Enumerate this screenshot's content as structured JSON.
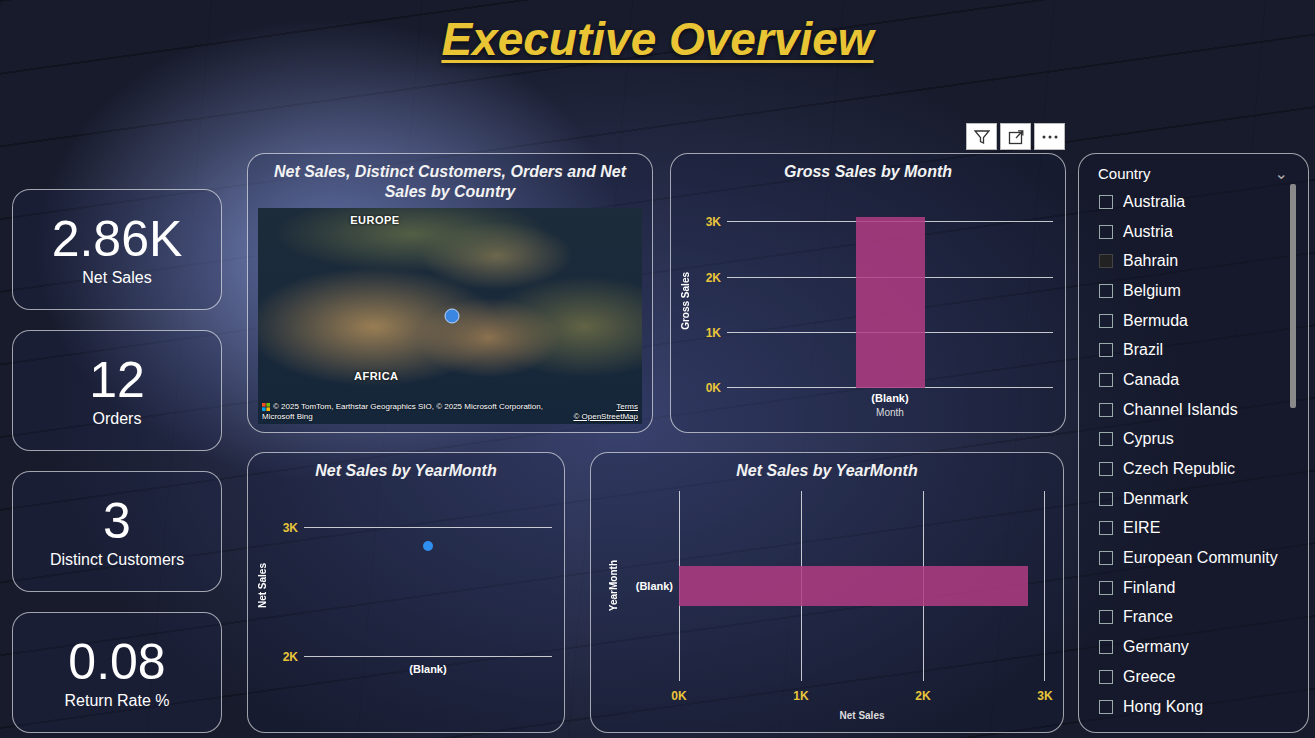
{
  "title": "Executive Overview",
  "kpis": [
    {
      "value": "2.86K",
      "label": "Net Sales"
    },
    {
      "value": "12",
      "label": "Orders"
    },
    {
      "value": "3",
      "label": "Distinct Customers"
    },
    {
      "value": "0.08",
      "label": "Return Rate %"
    }
  ],
  "map": {
    "title": "Net Sales, Distinct Customers, Orders and Net Sales by Country",
    "labels": [
      "EUROPE",
      "AFRICA"
    ],
    "attribution": "© 2025 TomTom, Earthstar Geographics SIO, © 2025 Microsoft Corporation,",
    "terms": "Terms",
    "brand": "Microsoft Bing",
    "osm": "© OpenStreetMap"
  },
  "gross_chart": {
    "title": "Gross Sales by Month",
    "y_axis_title": "Gross Sales",
    "x_axis_title": "Month",
    "ticks": [
      {
        "label": "3K",
        "value": 3000
      },
      {
        "label": "2K",
        "value": 2000
      },
      {
        "label": "1K",
        "value": 1000
      },
      {
        "label": "0K",
        "value": 0
      }
    ],
    "categories": [
      "(Blank)"
    ],
    "series": [
      {
        "name": "Gross Sales",
        "values": [
          3100
        ]
      }
    ]
  },
  "scatter_chart": {
    "title": "Net Sales by YearMonth",
    "y_axis_title": "Net Sales",
    "ticks": [
      {
        "label": "3K",
        "value": 3000
      },
      {
        "label": "2K",
        "value": 2000
      }
    ],
    "categories": [
      "(Blank)"
    ],
    "series": [
      {
        "name": "Net Sales",
        "values": [
          2860
        ]
      }
    ]
  },
  "bar_chart": {
    "title": "Net Sales by YearMonth",
    "x_axis_title": "Net Sales",
    "y_axis_title": "YearMonth",
    "ticks": [
      {
        "label": "0K",
        "value": 0
      },
      {
        "label": "1K",
        "value": 1000
      },
      {
        "label": "2K",
        "value": 2000
      },
      {
        "label": "3K",
        "value": 3000
      }
    ],
    "categories": [
      "(Blank)"
    ],
    "series": [
      {
        "name": "Net Sales",
        "values": [
          2860
        ]
      }
    ]
  },
  "slicer": {
    "title": "Country",
    "chevron": "⌄",
    "items": [
      {
        "label": "Australia",
        "selected": false
      },
      {
        "label": "Austria",
        "selected": false
      },
      {
        "label": "Bahrain",
        "selected": true
      },
      {
        "label": "Belgium",
        "selected": false
      },
      {
        "label": "Bermuda",
        "selected": false
      },
      {
        "label": "Brazil",
        "selected": false
      },
      {
        "label": "Canada",
        "selected": false
      },
      {
        "label": "Channel Islands",
        "selected": false
      },
      {
        "label": "Cyprus",
        "selected": false
      },
      {
        "label": "Czech Republic",
        "selected": false
      },
      {
        "label": "Denmark",
        "selected": false
      },
      {
        "label": "EIRE",
        "selected": false
      },
      {
        "label": "European Community",
        "selected": false
      },
      {
        "label": "Finland",
        "selected": false
      },
      {
        "label": "France",
        "selected": false
      },
      {
        "label": "Germany",
        "selected": false
      },
      {
        "label": "Greece",
        "selected": false
      },
      {
        "label": "Hong Kong",
        "selected": false
      }
    ],
    "scrollbar": {
      "level": 0.43
    }
  }
}
